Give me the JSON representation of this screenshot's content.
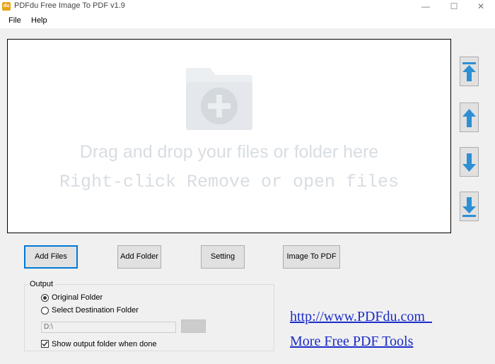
{
  "window": {
    "title": "PDFdu Free Image To PDF  v1.9",
    "icon_text": "du"
  },
  "menu": {
    "file": "File",
    "help": "Help"
  },
  "dropzone": {
    "line1": "Drag and drop your files or folder here",
    "line2": "Right-click Remove or open files"
  },
  "order_buttons": [
    "move-to-top-icon",
    "move-up-icon",
    "move-down-icon",
    "move-to-bottom-icon"
  ],
  "buttons": {
    "add_files": "Add Files",
    "add_folder": "Add Folder",
    "setting": "Setting",
    "convert": "Image To PDF"
  },
  "output": {
    "label": "Output",
    "original_folder": "Original Folder",
    "select_destination": "Select Destination Folder",
    "path_value": "D:\\",
    "selected": "original",
    "show_folder": "Show output folder when done",
    "show_folder_checked": true
  },
  "links": {
    "site": "http://www.PDFdu.com  ",
    "more": "More Free PDF Tools"
  },
  "colors": {
    "link": "#1a2cc9",
    "arrow": "#2e8fd3",
    "default_button_border": "#0078d7"
  }
}
